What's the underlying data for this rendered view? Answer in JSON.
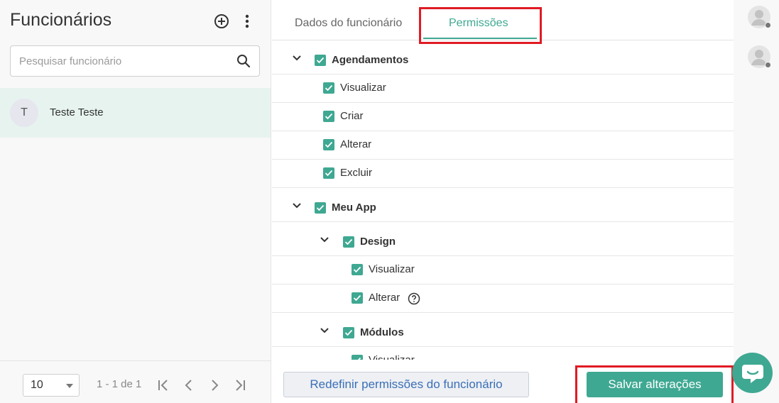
{
  "sidebar": {
    "title": "Funcionários",
    "search_placeholder": "Pesquisar funcionário",
    "employees": [
      {
        "initial": "T",
        "name": "Teste Teste"
      }
    ],
    "page_size": "10",
    "range_text": "1 - 1 de 1"
  },
  "tabs": {
    "dados": "Dados do funcionário",
    "permissoes": "Permissões"
  },
  "permissions": {
    "agendamentos": {
      "label": "Agendamentos",
      "items": [
        "Visualizar",
        "Criar",
        "Alterar",
        "Excluir"
      ]
    },
    "meu_app": {
      "label": "Meu App",
      "design": {
        "label": "Design",
        "items": [
          "Visualizar",
          "Alterar"
        ]
      },
      "modulos": {
        "label": "Módulos",
        "items": [
          "Visualizar"
        ]
      }
    }
  },
  "footer": {
    "reset_label": "Redefinir permissões do funcionário",
    "save_label": "Salvar alterações"
  },
  "colors": {
    "accent": "#3fa892",
    "highlight": "#e01b24",
    "link": "#3b6fb6"
  }
}
